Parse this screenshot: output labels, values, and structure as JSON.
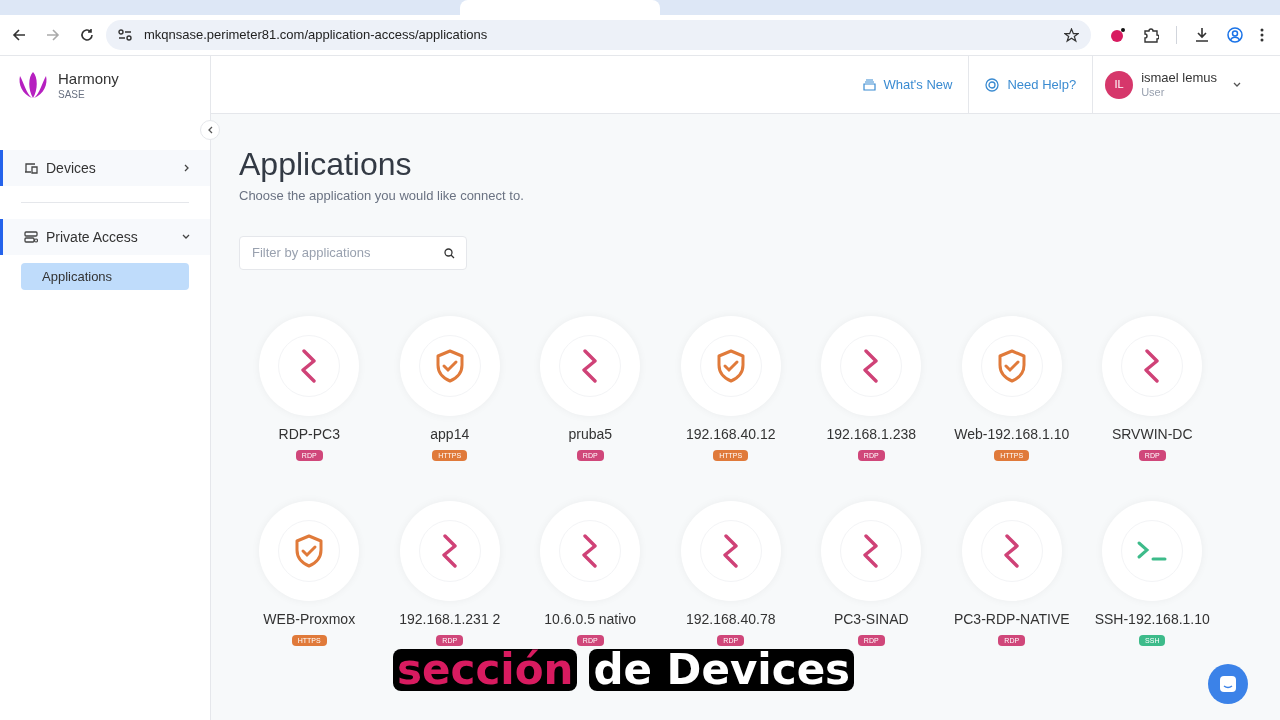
{
  "browser": {
    "url": "mkqnsase.perimeter81.com/application-access/applications"
  },
  "brand": {
    "name": "Harmony",
    "product": "SASE"
  },
  "sidebar": {
    "items": [
      {
        "label": "Devices",
        "selected": true,
        "expanded": false,
        "kind": "devices"
      },
      {
        "label": "Private Access",
        "selected": true,
        "expanded": true,
        "kind": "private",
        "children": [
          {
            "label": "Applications",
            "selected": true
          }
        ]
      }
    ]
  },
  "header": {
    "whats_new": "What's New",
    "need_help": "Need Help?",
    "user": {
      "initials": "IL",
      "name": "ismael lemus",
      "role": "User"
    }
  },
  "page": {
    "title": "Applications",
    "subtitle": "Choose the application you would like connect to.",
    "search": {
      "placeholder": "Filter by applications"
    }
  },
  "apps": [
    {
      "name": "RDP-PC3",
      "kind": "rdp",
      "protocol": "RDP"
    },
    {
      "name": "app14",
      "kind": "https",
      "protocol": "HTTPS"
    },
    {
      "name": "pruba5",
      "kind": "rdp",
      "protocol": "RDP"
    },
    {
      "name": "192.168.40.12",
      "kind": "https",
      "protocol": "HTTPS"
    },
    {
      "name": "192.168.1.238",
      "kind": "rdp",
      "protocol": "RDP"
    },
    {
      "name": "Web-192.168.1.10",
      "kind": "https",
      "protocol": "HTTPS"
    },
    {
      "name": "SRVWIN-DC",
      "kind": "rdp",
      "protocol": "RDP"
    },
    {
      "name": "WEB-Proxmox",
      "kind": "https",
      "protocol": "HTTPS"
    },
    {
      "name": "192.168.1.231 2",
      "kind": "rdp",
      "protocol": "RDP"
    },
    {
      "name": "10.6.0.5 nativo",
      "kind": "rdp",
      "protocol": "RDP"
    },
    {
      "name": "192.168.40.78",
      "kind": "rdp",
      "protocol": "RDP"
    },
    {
      "name": "PC3-SINAD",
      "kind": "rdp",
      "protocol": "RDP"
    },
    {
      "name": "PC3-RDP-NATIVE",
      "kind": "rdp",
      "protocol": "RDP"
    },
    {
      "name": "SSH-192.168.1.10",
      "kind": "ssh",
      "protocol": "SSH"
    }
  ],
  "caption": [
    {
      "text": "sección",
      "kind": "highlight"
    },
    {
      "text": "de Devices",
      "kind": "plain"
    }
  ]
}
